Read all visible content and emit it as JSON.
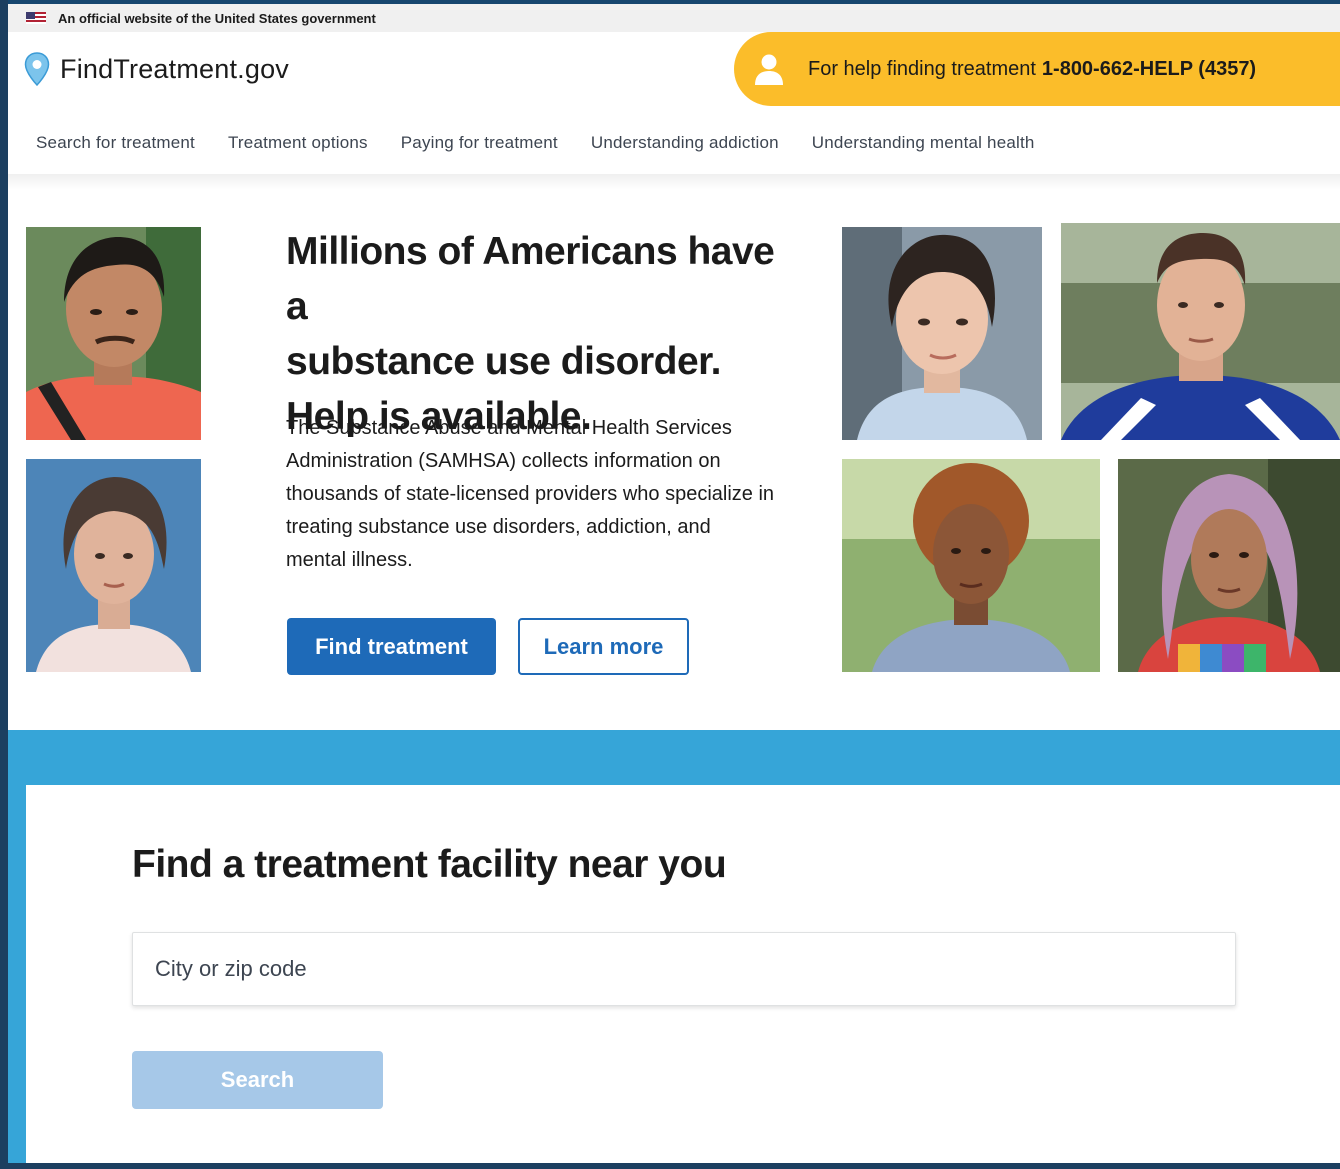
{
  "gov_banner": {
    "text": "An official website of the United States government"
  },
  "header": {
    "logo_text": "FindTreatment.gov",
    "help_text": "For help finding treatment",
    "help_phone": "1-800-662-HELP (4357)"
  },
  "nav": {
    "items": [
      {
        "label": "Search for treatment"
      },
      {
        "label": "Treatment options"
      },
      {
        "label": "Paying for treatment"
      },
      {
        "label": "Understanding addiction"
      },
      {
        "label": "Understanding mental health"
      }
    ]
  },
  "hero": {
    "title_lines": [
      "Millions of Americans have a",
      "substance use disorder.",
      "Help is available."
    ],
    "body": "The Substance Abuse and Mental Health Services Administration (SAMHSA) collects information on thousands of state-licensed providers who specialize in treating substance use disorders, addiction, and mental illness.",
    "primary_button": "Find treatment",
    "secondary_button": "Learn more"
  },
  "search": {
    "title": "Find a treatment facility near you",
    "placeholder": "City or zip code",
    "button": "Search"
  },
  "colors": {
    "primary_blue": "#1e6ab8",
    "help_yellow": "#fbbd2a",
    "band_blue": "#36a5d8",
    "disabled_blue": "#a6c8e8"
  }
}
